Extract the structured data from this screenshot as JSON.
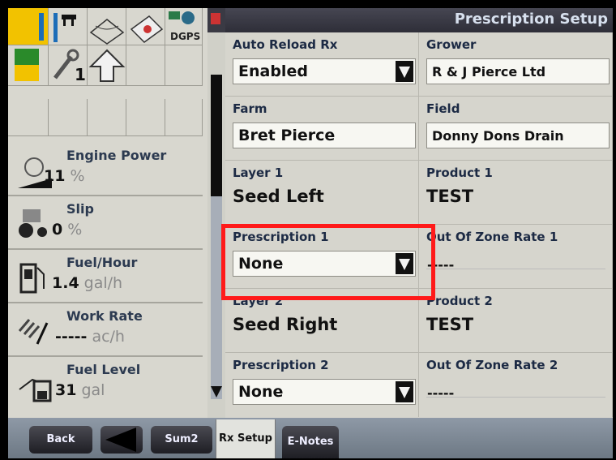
{
  "left_panel": {
    "shortcut_icons": [
      "ground-speed-icon",
      "implement-icon",
      "field-icon",
      "tractor-icon",
      "dgps-icon",
      "ladder-icon",
      "wrench-icon",
      "up-arrow-icon"
    ],
    "dgps_label": "DGPS",
    "wrench_count": "1",
    "gauges": [
      {
        "label": "Engine Power",
        "value": "11",
        "unit": "%",
        "icon": "engine-icon"
      },
      {
        "label": "Slip",
        "value": "0",
        "unit": "%",
        "icon": "tractor-slip-icon"
      },
      {
        "label": "Fuel/Hour",
        "value": "1.4",
        "unit": "gal/h",
        "icon": "fuel-pump-icon"
      },
      {
        "label": "Work Rate",
        "value": "-----",
        "unit": "ac/h",
        "icon": "work-rate-icon"
      },
      {
        "label": "Fuel Level",
        "value": "31",
        "unit": "gal",
        "icon": "fuel-level-icon"
      }
    ]
  },
  "header": {
    "title": "Prescription Setup"
  },
  "fields": {
    "auto_reload": {
      "label": "Auto Reload Rx",
      "value": "Enabled"
    },
    "grower": {
      "label": "Grower",
      "value": "R & J Pierce Ltd"
    },
    "farm": {
      "label": "Farm",
      "value": "Bret Pierce"
    },
    "field": {
      "label": "Field",
      "value": "Donny Dons Drain"
    },
    "layer1": {
      "label": "Layer 1",
      "value": "Seed Left"
    },
    "product1": {
      "label": "Product 1",
      "value": "TEST"
    },
    "prescription1": {
      "label": "Prescription 1",
      "value": "None"
    },
    "ozr1": {
      "label": "Out Of Zone Rate 1",
      "value": "-----"
    },
    "layer2": {
      "label": "Layer 2",
      "value": "Seed Right"
    },
    "product2": {
      "label": "Product 2",
      "value": "TEST"
    },
    "prescription2": {
      "label": "Prescription 2",
      "value": "None"
    },
    "ozr2": {
      "label": "Out Of Zone Rate 2",
      "value": "-----"
    }
  },
  "bottom_bar": {
    "back": "Back",
    "sum2": "Sum2",
    "rx_setup": "Rx Setup",
    "e_notes": "E-Notes"
  },
  "colors": {
    "highlight": "#ff1a1a",
    "accent_yellow": "#f2c200"
  }
}
